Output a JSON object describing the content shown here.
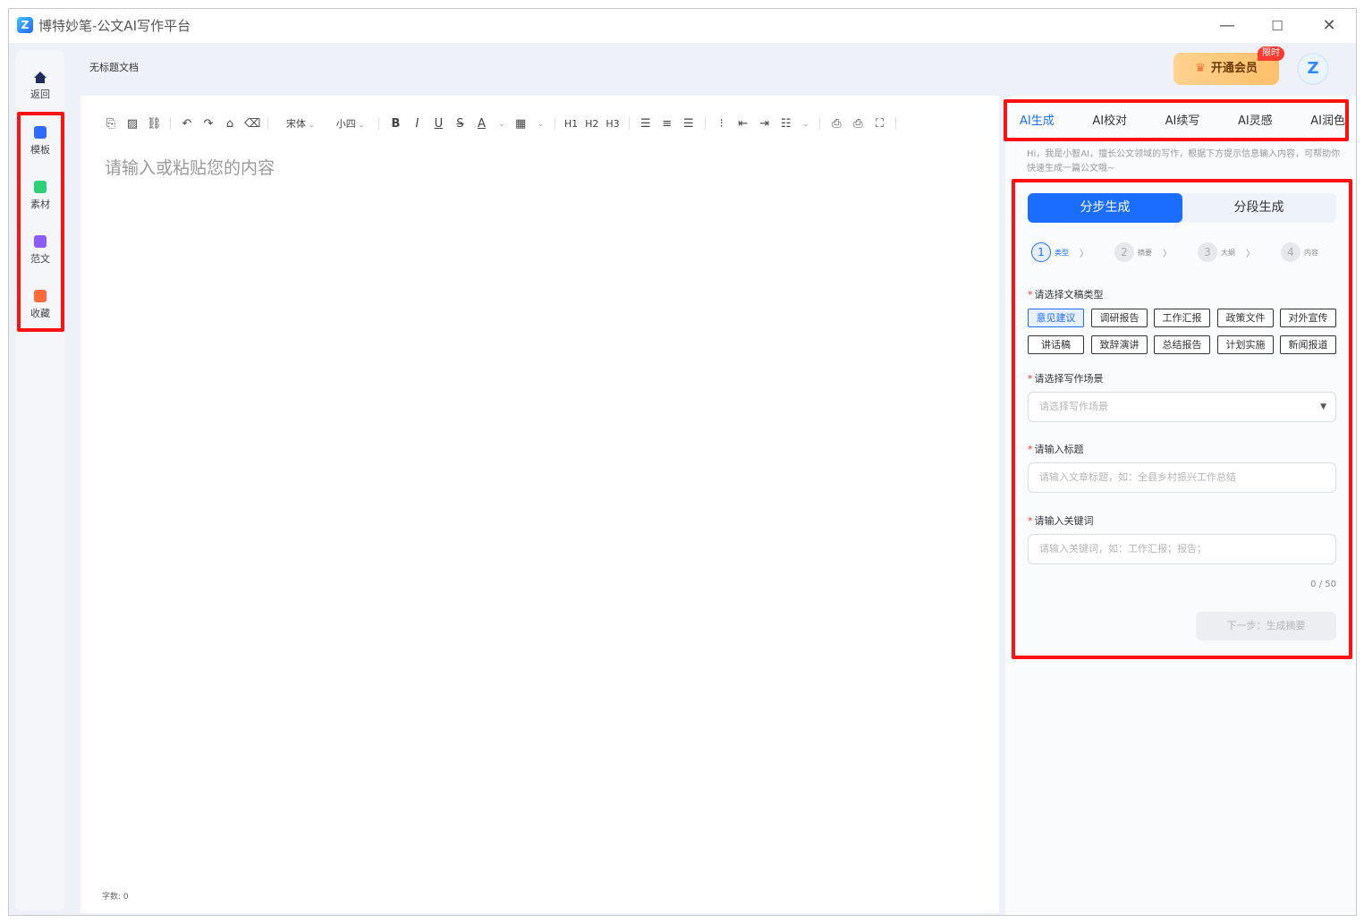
{
  "window": {
    "title": "博特妙笔-公文AI写作平台",
    "logo_glyph": "Z"
  },
  "nav": [
    {
      "label": "返回",
      "icon": "home-icon",
      "color": "#1f2d5c"
    },
    {
      "label": "模板",
      "icon": "template-icon",
      "color": "#2f6bff"
    },
    {
      "label": "素材",
      "icon": "material-icon",
      "color": "#2fcf7a"
    },
    {
      "label": "范文",
      "icon": "sample-essay-icon",
      "color": "#8b5cf6"
    },
    {
      "label": "收藏",
      "icon": "favorites-icon",
      "color": "#ff6a3d"
    }
  ],
  "document": {
    "title": "无标题文档",
    "placeholder": "请输入或粘贴您的内容",
    "word_count": "字数: 0"
  },
  "header": {
    "vip_label": "开通会员",
    "vip_badge": "限时",
    "avatar_glyph": "Z"
  },
  "toolbar": {
    "font_family": "宋体",
    "font_size": "小四",
    "bold": "B",
    "italic": "I",
    "underline": "U",
    "strike": "S",
    "font_color": "A",
    "h1": "H1",
    "h2": "H2",
    "h3": "H3"
  },
  "panel": {
    "tabs": [
      "AI生成",
      "AI校对",
      "AI续写",
      "AI灵感",
      "AI润色"
    ],
    "active_tab": "AI生成",
    "intro": "Hi，我是小智AI，擅长公文领域的写作，根据下方提示信息输入内容，可帮助你快速生成一篇公文哦~",
    "modes": {
      "step": "分步生成",
      "segment": "分段生成"
    },
    "steps": [
      {
        "num": "1",
        "label": "类型"
      },
      {
        "num": "2",
        "label": "摘要"
      },
      {
        "num": "3",
        "label": "大纲"
      },
      {
        "num": "4",
        "label": "内容"
      }
    ],
    "doc_type_label": "请选择文稿类型",
    "doc_types": [
      "意见建议",
      "调研报告",
      "工作汇报",
      "政策文件",
      "对外宣传",
      "讲话稿",
      "致辞演讲",
      "总结报告",
      "计划实施",
      "新闻报道"
    ],
    "active_doc_type": "意见建议",
    "scene_label": "请选择写作场景",
    "scene_placeholder": "请选择写作场景",
    "title_label": "请输入标题",
    "title_placeholder": "请输入文章标题，如：全县乡村振兴工作总结",
    "keyword_label": "请输入关键词",
    "keyword_placeholder": "请输入关键词，如：工作汇报；报告；",
    "counter": "0 / 50",
    "next_button": "下一步：生成摘要"
  },
  "colors": {
    "accent": "#1a6dff",
    "highlight": "#ff1111",
    "vip": "#ffc46e"
  }
}
